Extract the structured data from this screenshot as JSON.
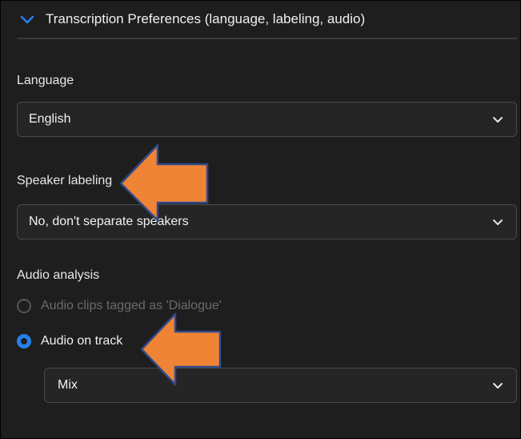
{
  "section": {
    "title": "Transcription Preferences (language, labeling, audio)"
  },
  "language": {
    "label": "Language",
    "value": "English"
  },
  "speaker_labeling": {
    "label": "Speaker labeling",
    "value": "No, don't separate speakers"
  },
  "audio_analysis": {
    "label": "Audio analysis",
    "options": [
      {
        "label": "Audio clips tagged as 'Dialogue'",
        "selected": false,
        "disabled": true
      },
      {
        "label": "Audio on track",
        "selected": true,
        "disabled": false
      }
    ],
    "track_value": "Mix"
  },
  "colors": {
    "accent": "#2680eb",
    "annotation_arrow": "#ef8436",
    "arrow_outline": "#2f4a8a"
  }
}
